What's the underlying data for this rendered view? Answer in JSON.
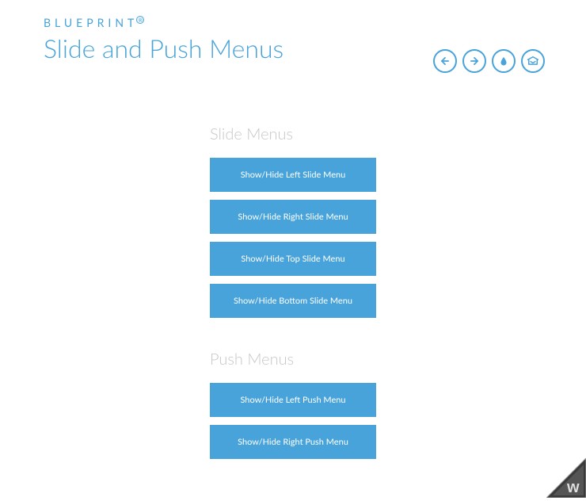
{
  "brand": {
    "text": "BLUEPRINT",
    "mark": "®"
  },
  "title": "Slide and Push Menus",
  "nav": {
    "back": "arrow-left-icon",
    "forward": "arrow-right-icon",
    "drop": "drop-icon",
    "archive": "archive-icon"
  },
  "sections": [
    {
      "title": "Slide Menus",
      "buttons": [
        "Show/Hide Left Slide Menu",
        "Show/Hide Right Slide Menu",
        "Show/Hide Top Slide Menu",
        "Show/Hide Bottom Slide Menu"
      ]
    },
    {
      "title": "Push Menus",
      "buttons": [
        "Show/Hide Left Push Menu",
        "Show/Hide Right Push Menu"
      ]
    }
  ]
}
